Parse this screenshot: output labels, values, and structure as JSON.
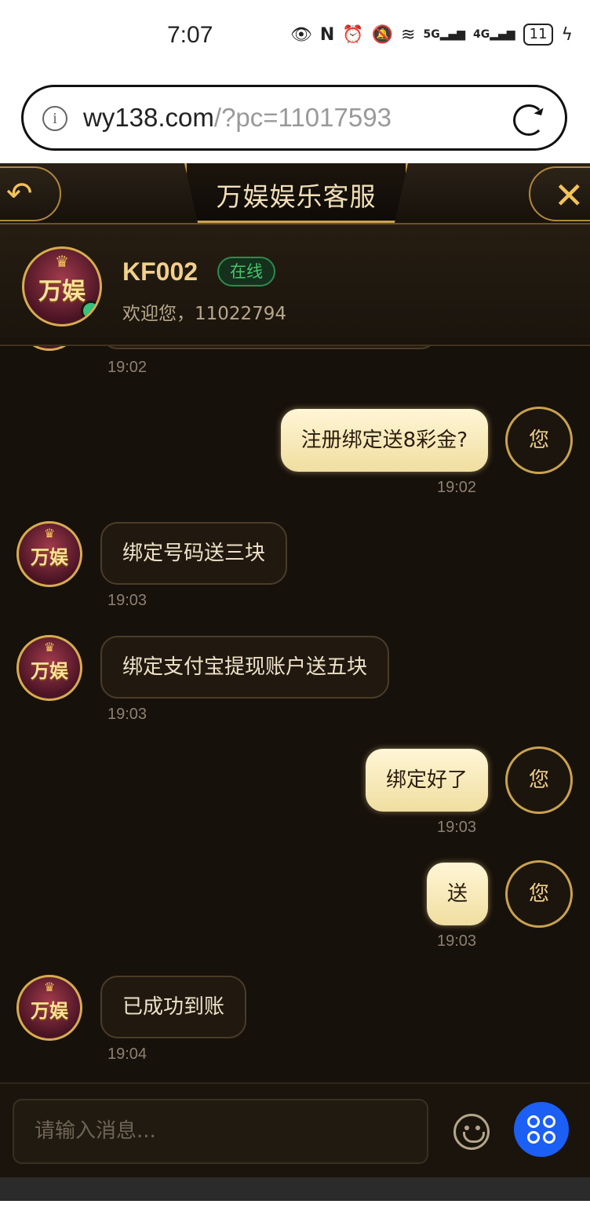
{
  "status_bar": {
    "time": "7:07",
    "icons": [
      "eye-icon",
      "nfc-icon",
      "alarm-icon",
      "mute-icon",
      "wifi-icon",
      "5g-signal-icon",
      "4g-signal-icon",
      "battery-icon",
      "charging-icon"
    ],
    "signal_5g": "5G",
    "signal_4g": "4G",
    "battery": "11"
  },
  "browser": {
    "url_host": "wy138.com",
    "url_rest": "/?pc=11017593",
    "info_glyph": "i"
  },
  "app": {
    "title": "万娱娱乐客服",
    "back_glyph": "↶",
    "close_glyph": "✕",
    "agent": {
      "name": "KF002",
      "status": "在线",
      "welcome": "欢迎您，11022794",
      "logo_text": "万娱"
    },
    "me_label": "您",
    "messages": [
      {
        "from": "agent",
        "text": "",
        "time": "19:02"
      },
      {
        "from": "me",
        "text": "注册绑定送8彩金?",
        "time": "19:02"
      },
      {
        "from": "agent",
        "text": "绑定号码送三块",
        "time": "19:03"
      },
      {
        "from": "agent",
        "text": "绑定支付宝提现账户送五块",
        "time": "19:03"
      },
      {
        "from": "me",
        "text": "绑定好了",
        "time": "19:03"
      },
      {
        "from": "me",
        "text": "送",
        "time": "19:03"
      },
      {
        "from": "agent",
        "text": "已成功到账",
        "time": "19:04"
      }
    ],
    "input": {
      "placeholder": "请输入消息..."
    }
  },
  "colors": {
    "background": "#17110b",
    "gold": "#d7ac4f",
    "me_bubble": "#f6e7b4",
    "online_green": "#45c46e",
    "action_blue": "#1b5ff5"
  }
}
